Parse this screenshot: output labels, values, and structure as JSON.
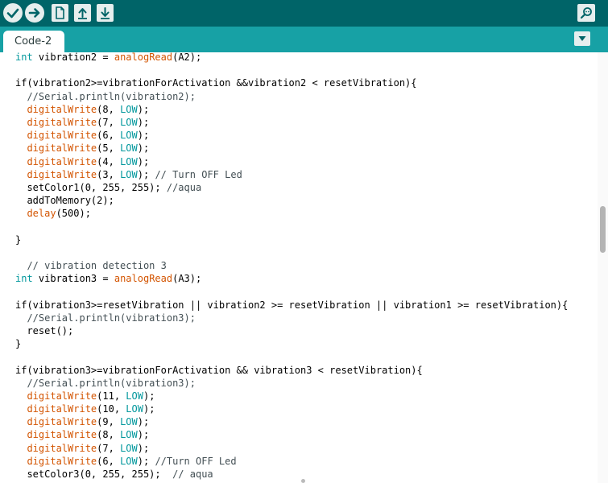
{
  "toolbar": {
    "buttons": [
      {
        "name": "verify-button",
        "icon": "check-icon"
      },
      {
        "name": "upload-button",
        "icon": "arrow-right-icon"
      },
      {
        "name": "new-button",
        "icon": "new-file-icon"
      },
      {
        "name": "open-button",
        "icon": "arrow-up-icon"
      },
      {
        "name": "save-button",
        "icon": "arrow-down-icon"
      },
      {
        "name": "serial-monitor-button",
        "icon": "magnifier-icon"
      }
    ],
    "colors": {
      "bar": "#006468",
      "button": "#e6eeee",
      "icon": "#006468"
    }
  },
  "tabs": [
    {
      "label": "Code-2",
      "active": true
    }
  ],
  "tab_menu_icon": "triangle-down-icon",
  "syntax_colors": {
    "type": "#00979c",
    "function": "#d35400",
    "constant": "#00979c",
    "comment": "#434f54"
  },
  "editor": {
    "lines": [
      [
        {
          "t": "int",
          "c": "type"
        },
        {
          "t": " vibration2 = ",
          "c": "plain"
        },
        {
          "t": "analogRead",
          "c": "fn"
        },
        {
          "t": "(A2);",
          "c": "plain"
        }
      ],
      [],
      [
        {
          "t": "if(vibration2>=vibrationForActivation &&vibration2 < resetVibration){",
          "c": "plain"
        }
      ],
      [
        {
          "t": "  //Serial.println(vibration2);",
          "c": "comment"
        }
      ],
      [
        {
          "t": "  ",
          "c": "plain"
        },
        {
          "t": "digitalWrite",
          "c": "fn"
        },
        {
          "t": "(8, ",
          "c": "plain"
        },
        {
          "t": "LOW",
          "c": "const"
        },
        {
          "t": ");",
          "c": "plain"
        }
      ],
      [
        {
          "t": "  ",
          "c": "plain"
        },
        {
          "t": "digitalWrite",
          "c": "fn"
        },
        {
          "t": "(7, ",
          "c": "plain"
        },
        {
          "t": "LOW",
          "c": "const"
        },
        {
          "t": ");",
          "c": "plain"
        }
      ],
      [
        {
          "t": "  ",
          "c": "plain"
        },
        {
          "t": "digitalWrite",
          "c": "fn"
        },
        {
          "t": "(6, ",
          "c": "plain"
        },
        {
          "t": "LOW",
          "c": "const"
        },
        {
          "t": ");",
          "c": "plain"
        }
      ],
      [
        {
          "t": "  ",
          "c": "plain"
        },
        {
          "t": "digitalWrite",
          "c": "fn"
        },
        {
          "t": "(5, ",
          "c": "plain"
        },
        {
          "t": "LOW",
          "c": "const"
        },
        {
          "t": ");",
          "c": "plain"
        }
      ],
      [
        {
          "t": "  ",
          "c": "plain"
        },
        {
          "t": "digitalWrite",
          "c": "fn"
        },
        {
          "t": "(4, ",
          "c": "plain"
        },
        {
          "t": "LOW",
          "c": "const"
        },
        {
          "t": ");",
          "c": "plain"
        }
      ],
      [
        {
          "t": "  ",
          "c": "plain"
        },
        {
          "t": "digitalWrite",
          "c": "fn"
        },
        {
          "t": "(3, ",
          "c": "plain"
        },
        {
          "t": "LOW",
          "c": "const"
        },
        {
          "t": "); ",
          "c": "plain"
        },
        {
          "t": "// Turn OFF Led",
          "c": "comment"
        }
      ],
      [
        {
          "t": "  setColor1(0, 255, 255); ",
          "c": "plain"
        },
        {
          "t": "//aqua",
          "c": "comment"
        }
      ],
      [
        {
          "t": "  addToMemory(2);",
          "c": "plain"
        }
      ],
      [
        {
          "t": "  ",
          "c": "plain"
        },
        {
          "t": "delay",
          "c": "fn"
        },
        {
          "t": "(500);",
          "c": "plain"
        }
      ],
      [],
      [
        {
          "t": "}",
          "c": "plain"
        }
      ],
      [],
      [
        {
          "t": "  // vibration detection 3",
          "c": "comment"
        }
      ],
      [
        {
          "t": "int",
          "c": "type"
        },
        {
          "t": " vibration3 = ",
          "c": "plain"
        },
        {
          "t": "analogRead",
          "c": "fn"
        },
        {
          "t": "(A3);",
          "c": "plain"
        }
      ],
      [],
      [
        {
          "t": "if(vibration3>=resetVibration || vibration2 >= resetVibration || vibration1 >= resetVibration){",
          "c": "plain"
        }
      ],
      [
        {
          "t": "  //Serial.println(vibration3);",
          "c": "comment"
        }
      ],
      [
        {
          "t": "  reset();",
          "c": "plain"
        }
      ],
      [
        {
          "t": "}",
          "c": "plain"
        }
      ],
      [],
      [
        {
          "t": "if(vibration3>=vibrationForActivation && vibration3 < resetVibration){",
          "c": "plain"
        }
      ],
      [
        {
          "t": "  //Serial.println(vibration3);",
          "c": "comment"
        }
      ],
      [
        {
          "t": "  ",
          "c": "plain"
        },
        {
          "t": "digitalWrite",
          "c": "fn"
        },
        {
          "t": "(11, ",
          "c": "plain"
        },
        {
          "t": "LOW",
          "c": "const"
        },
        {
          "t": ");",
          "c": "plain"
        }
      ],
      [
        {
          "t": "  ",
          "c": "plain"
        },
        {
          "t": "digitalWrite",
          "c": "fn"
        },
        {
          "t": "(10, ",
          "c": "plain"
        },
        {
          "t": "LOW",
          "c": "const"
        },
        {
          "t": ");",
          "c": "plain"
        }
      ],
      [
        {
          "t": "  ",
          "c": "plain"
        },
        {
          "t": "digitalWrite",
          "c": "fn"
        },
        {
          "t": "(9, ",
          "c": "plain"
        },
        {
          "t": "LOW",
          "c": "const"
        },
        {
          "t": ");",
          "c": "plain"
        }
      ],
      [
        {
          "t": "  ",
          "c": "plain"
        },
        {
          "t": "digitalWrite",
          "c": "fn"
        },
        {
          "t": "(8, ",
          "c": "plain"
        },
        {
          "t": "LOW",
          "c": "const"
        },
        {
          "t": ");",
          "c": "plain"
        }
      ],
      [
        {
          "t": "  ",
          "c": "plain"
        },
        {
          "t": "digitalWrite",
          "c": "fn"
        },
        {
          "t": "(7, ",
          "c": "plain"
        },
        {
          "t": "LOW",
          "c": "const"
        },
        {
          "t": ");",
          "c": "plain"
        }
      ],
      [
        {
          "t": "  ",
          "c": "plain"
        },
        {
          "t": "digitalWrite",
          "c": "fn"
        },
        {
          "t": "(6, ",
          "c": "plain"
        },
        {
          "t": "LOW",
          "c": "const"
        },
        {
          "t": "); ",
          "c": "plain"
        },
        {
          "t": "//Turn OFF Led",
          "c": "comment"
        }
      ],
      [
        {
          "t": "  setColor3(0, 255, 255);  ",
          "c": "plain"
        },
        {
          "t": "// aqua",
          "c": "comment"
        }
      ]
    ]
  }
}
